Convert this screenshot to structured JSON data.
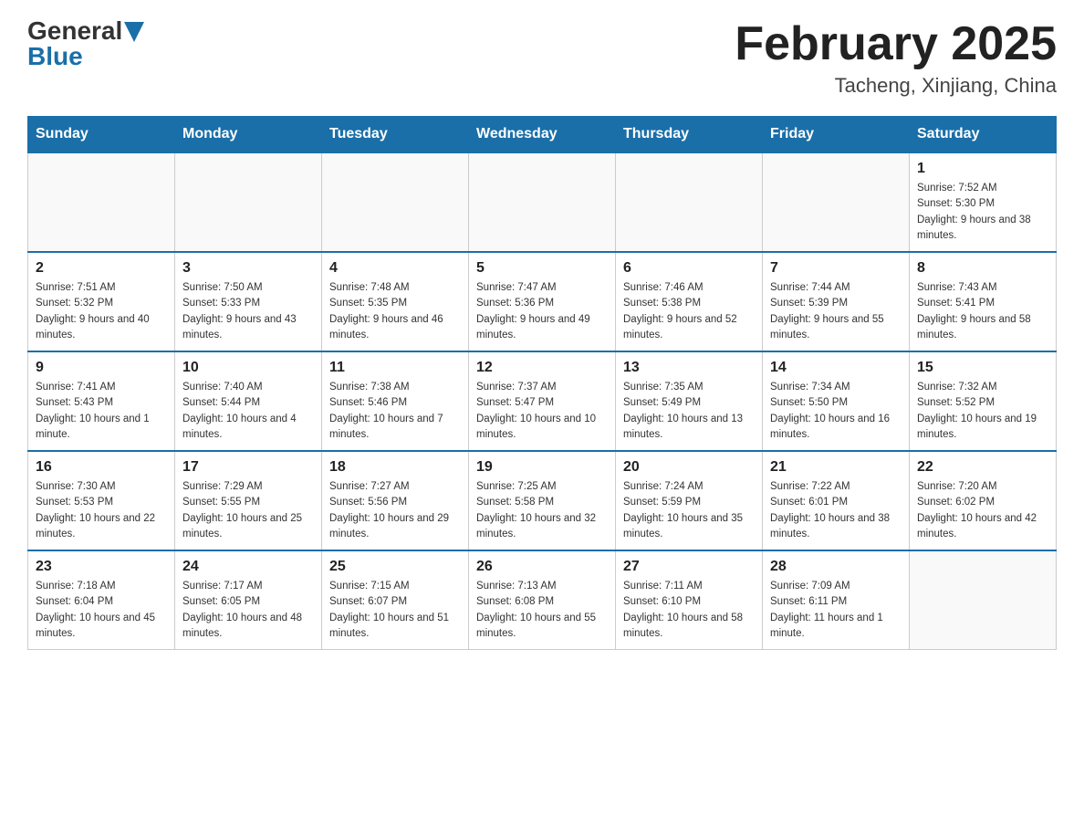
{
  "header": {
    "logo_general": "General",
    "logo_blue": "Blue",
    "title": "February 2025",
    "subtitle": "Tacheng, Xinjiang, China"
  },
  "days_of_week": [
    "Sunday",
    "Monday",
    "Tuesday",
    "Wednesday",
    "Thursday",
    "Friday",
    "Saturday"
  ],
  "weeks": [
    {
      "days": [
        {
          "number": "",
          "info": ""
        },
        {
          "number": "",
          "info": ""
        },
        {
          "number": "",
          "info": ""
        },
        {
          "number": "",
          "info": ""
        },
        {
          "number": "",
          "info": ""
        },
        {
          "number": "",
          "info": ""
        },
        {
          "number": "1",
          "info": "Sunrise: 7:52 AM\nSunset: 5:30 PM\nDaylight: 9 hours and 38 minutes."
        }
      ]
    },
    {
      "days": [
        {
          "number": "2",
          "info": "Sunrise: 7:51 AM\nSunset: 5:32 PM\nDaylight: 9 hours and 40 minutes."
        },
        {
          "number": "3",
          "info": "Sunrise: 7:50 AM\nSunset: 5:33 PM\nDaylight: 9 hours and 43 minutes."
        },
        {
          "number": "4",
          "info": "Sunrise: 7:48 AM\nSunset: 5:35 PM\nDaylight: 9 hours and 46 minutes."
        },
        {
          "number": "5",
          "info": "Sunrise: 7:47 AM\nSunset: 5:36 PM\nDaylight: 9 hours and 49 minutes."
        },
        {
          "number": "6",
          "info": "Sunrise: 7:46 AM\nSunset: 5:38 PM\nDaylight: 9 hours and 52 minutes."
        },
        {
          "number": "7",
          "info": "Sunrise: 7:44 AM\nSunset: 5:39 PM\nDaylight: 9 hours and 55 minutes."
        },
        {
          "number": "8",
          "info": "Sunrise: 7:43 AM\nSunset: 5:41 PM\nDaylight: 9 hours and 58 minutes."
        }
      ]
    },
    {
      "days": [
        {
          "number": "9",
          "info": "Sunrise: 7:41 AM\nSunset: 5:43 PM\nDaylight: 10 hours and 1 minute."
        },
        {
          "number": "10",
          "info": "Sunrise: 7:40 AM\nSunset: 5:44 PM\nDaylight: 10 hours and 4 minutes."
        },
        {
          "number": "11",
          "info": "Sunrise: 7:38 AM\nSunset: 5:46 PM\nDaylight: 10 hours and 7 minutes."
        },
        {
          "number": "12",
          "info": "Sunrise: 7:37 AM\nSunset: 5:47 PM\nDaylight: 10 hours and 10 minutes."
        },
        {
          "number": "13",
          "info": "Sunrise: 7:35 AM\nSunset: 5:49 PM\nDaylight: 10 hours and 13 minutes."
        },
        {
          "number": "14",
          "info": "Sunrise: 7:34 AM\nSunset: 5:50 PM\nDaylight: 10 hours and 16 minutes."
        },
        {
          "number": "15",
          "info": "Sunrise: 7:32 AM\nSunset: 5:52 PM\nDaylight: 10 hours and 19 minutes."
        }
      ]
    },
    {
      "days": [
        {
          "number": "16",
          "info": "Sunrise: 7:30 AM\nSunset: 5:53 PM\nDaylight: 10 hours and 22 minutes."
        },
        {
          "number": "17",
          "info": "Sunrise: 7:29 AM\nSunset: 5:55 PM\nDaylight: 10 hours and 25 minutes."
        },
        {
          "number": "18",
          "info": "Sunrise: 7:27 AM\nSunset: 5:56 PM\nDaylight: 10 hours and 29 minutes."
        },
        {
          "number": "19",
          "info": "Sunrise: 7:25 AM\nSunset: 5:58 PM\nDaylight: 10 hours and 32 minutes."
        },
        {
          "number": "20",
          "info": "Sunrise: 7:24 AM\nSunset: 5:59 PM\nDaylight: 10 hours and 35 minutes."
        },
        {
          "number": "21",
          "info": "Sunrise: 7:22 AM\nSunset: 6:01 PM\nDaylight: 10 hours and 38 minutes."
        },
        {
          "number": "22",
          "info": "Sunrise: 7:20 AM\nSunset: 6:02 PM\nDaylight: 10 hours and 42 minutes."
        }
      ]
    },
    {
      "days": [
        {
          "number": "23",
          "info": "Sunrise: 7:18 AM\nSunset: 6:04 PM\nDaylight: 10 hours and 45 minutes."
        },
        {
          "number": "24",
          "info": "Sunrise: 7:17 AM\nSunset: 6:05 PM\nDaylight: 10 hours and 48 minutes."
        },
        {
          "number": "25",
          "info": "Sunrise: 7:15 AM\nSunset: 6:07 PM\nDaylight: 10 hours and 51 minutes."
        },
        {
          "number": "26",
          "info": "Sunrise: 7:13 AM\nSunset: 6:08 PM\nDaylight: 10 hours and 55 minutes."
        },
        {
          "number": "27",
          "info": "Sunrise: 7:11 AM\nSunset: 6:10 PM\nDaylight: 10 hours and 58 minutes."
        },
        {
          "number": "28",
          "info": "Sunrise: 7:09 AM\nSunset: 6:11 PM\nDaylight: 11 hours and 1 minute."
        },
        {
          "number": "",
          "info": ""
        }
      ]
    }
  ]
}
